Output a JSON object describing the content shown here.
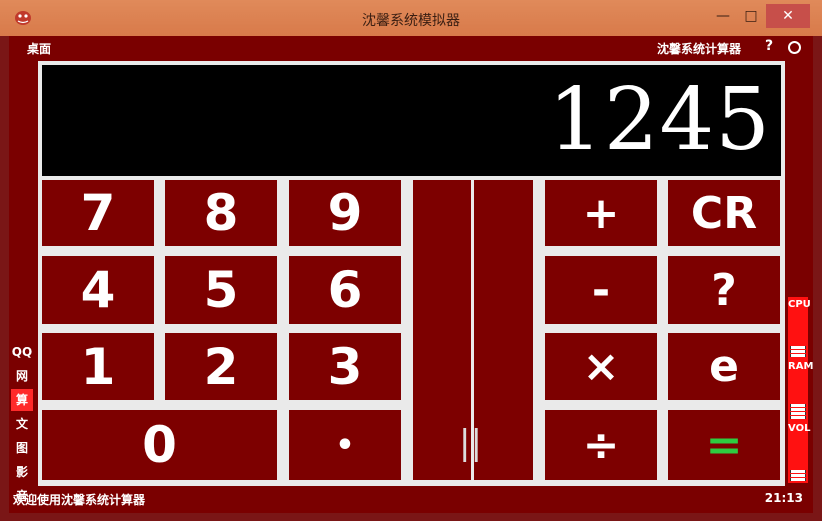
{
  "window": {
    "title": "沈馨系统模拟器",
    "minimize_glyph": "—",
    "maximize_glyph": "□",
    "close_glyph": "✕"
  },
  "topbar": {
    "desktop_label": "桌面",
    "app_name": "沈馨系统计算器",
    "help_label": "?"
  },
  "sidebar": {
    "items": [
      {
        "label": "QQ",
        "active": false
      },
      {
        "label": "网",
        "active": false
      },
      {
        "label": "算",
        "active": true
      },
      {
        "label": "文",
        "active": false
      },
      {
        "label": "图",
        "active": false
      },
      {
        "label": "影",
        "active": false
      },
      {
        "label": "音",
        "active": false
      }
    ]
  },
  "display": {
    "value": "1245"
  },
  "keys": {
    "k7": "7",
    "k8": "8",
    "k9": "9",
    "k4": "4",
    "k5": "5",
    "k6": "6",
    "k1": "1",
    "k2": "2",
    "k3": "3",
    "k0": "0",
    "dot": "•",
    "plus": "+",
    "clear": "CR",
    "minus": "-",
    "question": "?",
    "multiply": "×",
    "e": "e",
    "divide": "÷",
    "equals": "="
  },
  "cursor_glyph": "||",
  "meters": [
    {
      "label": "CPU"
    },
    {
      "label": "RAM"
    },
    {
      "label": "VOL"
    }
  ],
  "status": {
    "message": "欢迎使用沈馨系统计算器",
    "time": "21:13"
  },
  "colors": {
    "key_bg": "#7d0000",
    "frame_bg": "#7a0000",
    "equals_color": "#2ecc40",
    "meter_bg": "#ff1111",
    "active_tab": "#ff2a2a"
  }
}
